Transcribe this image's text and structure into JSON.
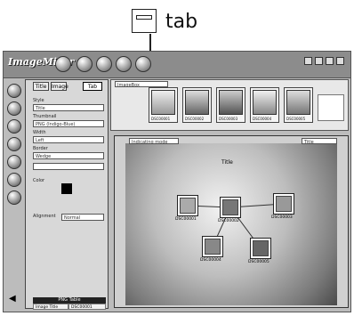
{
  "callout": {
    "label": "tab",
    "icon": "tab-icon"
  },
  "app": {
    "title": "ImageMixer"
  },
  "toolbar": {
    "icons": [
      "tb-icon-1",
      "tb-icon-2",
      "tb-icon-3",
      "tb-icon-4",
      "tb-icon-5"
    ]
  },
  "left_panel": {
    "tabs": [
      "Title",
      "Image",
      "Tab"
    ],
    "fields": [
      "Title",
      "PNG (Indigo-Blue)",
      "Left",
      "Wedge",
      "",
      "Normal"
    ],
    "labels": [
      "Style",
      "Thumbnail",
      "Width",
      "Border",
      "Color",
      "Alignment"
    ],
    "info_header": "PNG Table",
    "info_rows": [
      [
        "Image Title",
        "DSC00001"
      ],
      [
        "DSC00001.JPG",
        ""
      ]
    ]
  },
  "strip": {
    "dropdown": "ImageBox",
    "thumbs": [
      "DSC00001",
      "DSC00002",
      "DSC00003",
      "DSC00004",
      "DSC00005"
    ]
  },
  "map": {
    "left_dropdown": "Indicating mode",
    "right_dropdown": "Title",
    "center_label": "Title",
    "nodes": [
      "DSC00001",
      "DSC00002",
      "DSC00003",
      "DSC00004",
      "DSC00005"
    ]
  }
}
